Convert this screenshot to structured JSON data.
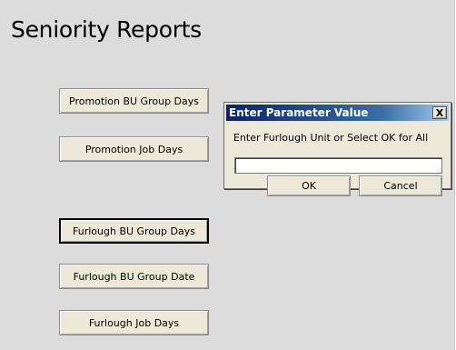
{
  "form": {
    "title": "Seniority Reports",
    "buttons": [
      {
        "label": "Promotion BU Group Days"
      },
      {
        "label": "Promotion Job Days"
      },
      {
        "label": "Furlough BU Group Days"
      },
      {
        "label": "Furlough BU Group Date"
      },
      {
        "label": "Furlough Job Days"
      }
    ]
  },
  "dialog": {
    "title": "Enter Parameter Value",
    "close_label": "X",
    "prompt": "Enter Furlough Unit or Select OK for All",
    "input_value": "",
    "ok_label": "OK",
    "cancel_label": "Cancel"
  },
  "colors": {
    "form_background": "#dcdcdc",
    "titlebar_start": "#0a246a",
    "titlebar_end": "#a6caf0"
  }
}
